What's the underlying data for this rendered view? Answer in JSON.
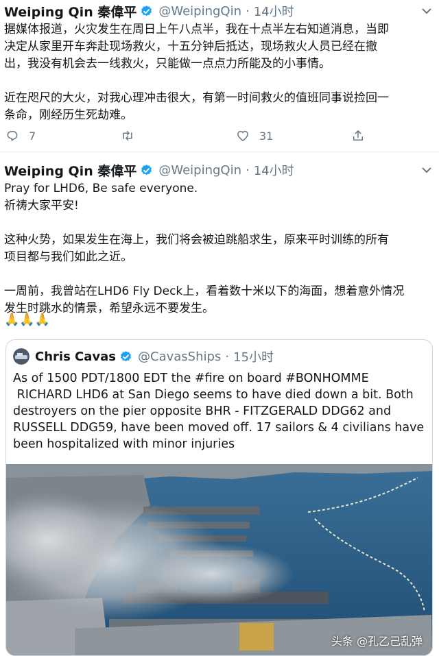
{
  "colors": {
    "accent": "#1da1f2",
    "muted": "#657786",
    "border": "#ccd6dd",
    "water": "#2c5d86"
  },
  "tweet1": {
    "name": "Weiping Qin 秦偉平",
    "handle": "@WeipingQin",
    "separator": "·",
    "time": "14小时",
    "text": "据媒体报道，火灾发生在周日上午八点半，我在十点半左右知道消息，当即\n决定从家里开车奔赴现场救火，十五分钟后抵达，现场救火人员已经在撤\n出，我没有机会去一线救火，只能做一点点力所能及的小事情。\n\n近在咫尺的大火，对我心理冲击很大，有第一时间救火的值班同事说捡回一\n条命，刚经历生死劫难。",
    "reply_count": "7",
    "like_count": "31"
  },
  "tweet2": {
    "name": "Weiping Qin 秦偉平",
    "handle": "@WeipingQin",
    "separator": "·",
    "time": "14小时",
    "text": "Pray for LHD6, Be safe everyone.\n祈祷大家平安!\n\n这种火势，如果发生在海上，我们将会被迫跳船求生，原来平时训练的所有\n项目都与我们如此之近。\n\n一周前，我曾站在LHD6 Fly Deck上，看着数十米以下的海面，想着意外情况\n发生时跳水的情景，希望永远不要发生。",
    "emoji": "🙏🙏🙏",
    "quote": {
      "name": "Chris Cavas",
      "handle": "@CavasShips",
      "separator": "·",
      "time": "15小时",
      "text": "As of 1500 PDT/1800 EDT the #fire on board #BONHOMME\n RICHARD LHD6 at San Diego seems to have died down a bit. Both\ndestroyers on the pier opposite BHR - FITZGERALD DDG62 and\nRUSSELL DDG59, have been moved off. 17 sailors & 4 civilians have\nbeen hospitalized with minor injuries",
      "image_icon": "aerial-harbor-fire-photo"
    }
  },
  "watermark": "头条 @孔乙己乱弹",
  "icons": [
    "verified-icon",
    "chevron-down-icon",
    "reply-icon",
    "retweet-icon",
    "heart-icon",
    "share-icon"
  ]
}
